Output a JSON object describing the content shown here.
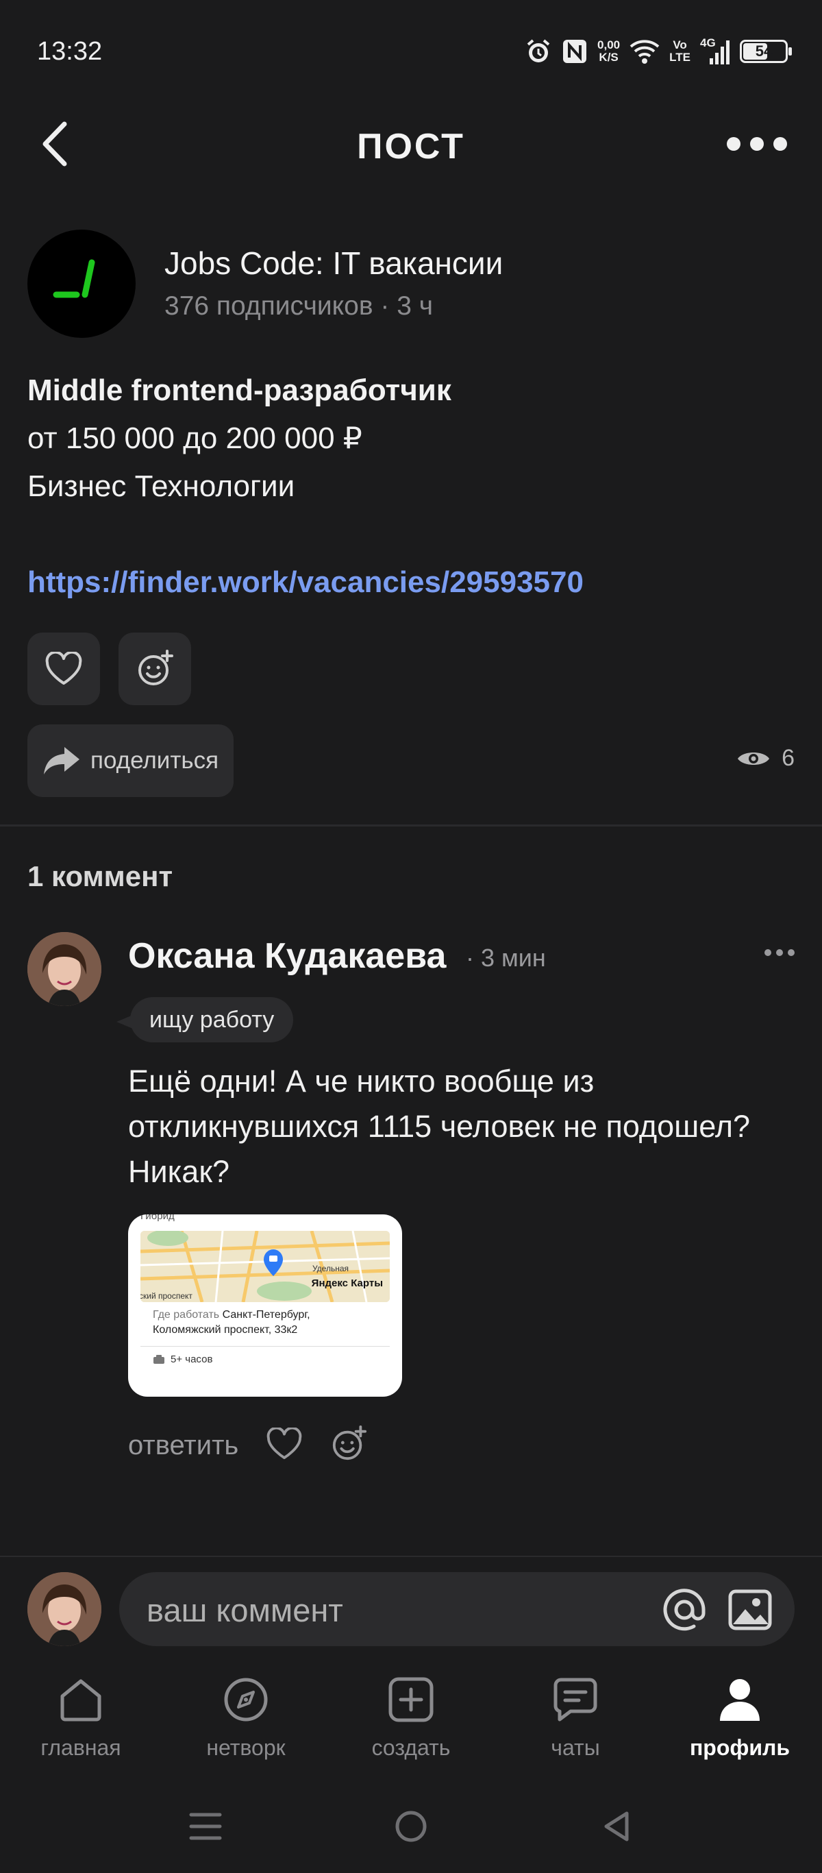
{
  "status_bar": {
    "time": "13:32",
    "net_speed_top": "0,00",
    "net_speed_bottom": "K/S",
    "volte_top": "Vo",
    "volte_bottom": "LTE",
    "network": "4G",
    "battery_level": "54",
    "battery_fraction": 0.54
  },
  "header": {
    "title": "ПОСТ"
  },
  "post": {
    "channel_name": "Jobs Code: IT вакансии",
    "channel_meta": "376 подписчиков · 3 ч",
    "title": "Middle frontend-разработчик",
    "salary": "от 150 000 до 200 000 ₽",
    "company": "Бизнес Технологии",
    "link": "https://finder.work/vacancies/29593570",
    "share_label": "поделиться",
    "views": "6"
  },
  "comments": {
    "count_label": "1 коммент",
    "items": [
      {
        "author": "Оксана Кудакаева",
        "time": "· 3 мин",
        "status": "ищу работу",
        "text": "Ещё одни! А че никто вообще из откликнувшихся 1115 человек не подошел? Никак?",
        "attachment": {
          "top_text": "Гибрид",
          "map_brand": "Яндекс Карты",
          "map_station": "Удельная",
          "map_street": "ский проспект",
          "where_label": "Где работать",
          "where_value_1": "Санкт-Петербург,",
          "where_value_2": "Коломяжский проспект, 33к2",
          "hours": "5+ часов"
        },
        "reply_label": "ответить"
      }
    ]
  },
  "composer": {
    "placeholder": "ваш коммент"
  },
  "nav": {
    "items": [
      {
        "label": "главная",
        "icon": "home-icon"
      },
      {
        "label": "нетворк",
        "icon": "compass-icon"
      },
      {
        "label": "создать",
        "icon": "plus-square-icon"
      },
      {
        "label": "чаты",
        "icon": "chat-icon"
      },
      {
        "label": "профиль",
        "icon": "profile-icon",
        "active": true
      }
    ]
  },
  "colors": {
    "background": "#1b1b1c",
    "surface": "#2b2b2d",
    "link": "#7a9cf0",
    "logo_green": "#1ec71e"
  }
}
